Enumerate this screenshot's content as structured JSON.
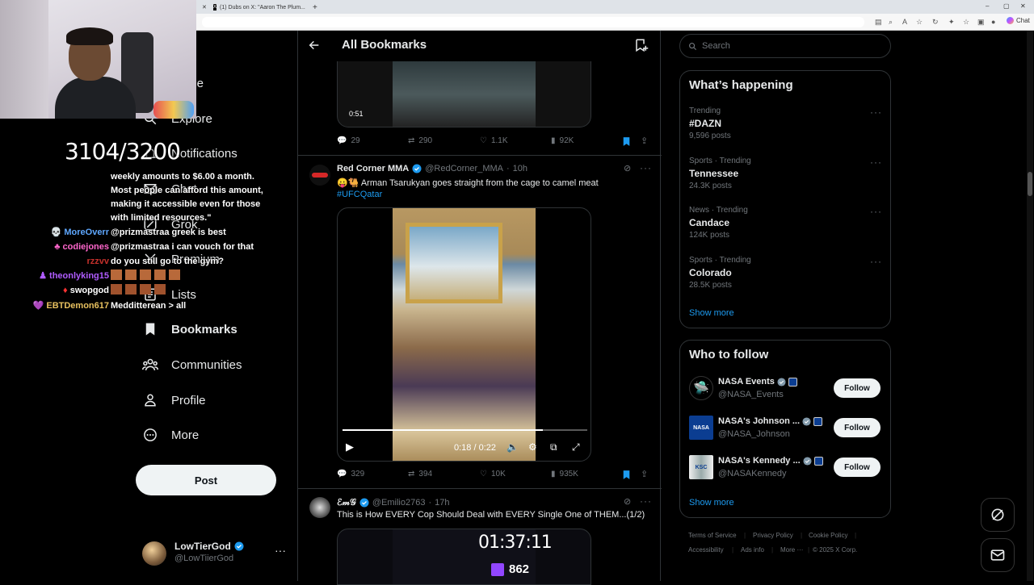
{
  "browser": {
    "tabs": [
      {
        "label": "(1) Dubs on X: \"Aaron The Plum..."
      }
    ],
    "new_tab": "+",
    "window_controls": [
      "–",
      "▢",
      "✕"
    ],
    "chat_label": "Chat"
  },
  "overlay": {
    "counter": "3104/3200",
    "chat": [
      {
        "user": "",
        "text": "weekly amounts to $6.00 a month."
      },
      {
        "user": "",
        "text": "Most people can afford this amount,"
      },
      {
        "user": "",
        "text": "making it accessible even for those"
      },
      {
        "user": "",
        "text": "with limited resources.\""
      },
      {
        "user": "MoreOverr",
        "text": "@prizmastraa greek is best",
        "color": "#5fa8ff"
      },
      {
        "user": "codiejones",
        "text": "@prizmastraa i can vouch for that",
        "color": "#ff66cc"
      },
      {
        "user": "rzzvv",
        "text": "do you still go to the gym?",
        "color": "#c4302b"
      },
      {
        "user": "theonlyking15",
        "text": "",
        "color": "#b05cff"
      },
      {
        "user": "swopgod",
        "text": "",
        "color": "#ffffff"
      },
      {
        "user": "EBTDemon617",
        "text": "Medditterean > all",
        "color": "#e8c15f"
      }
    ]
  },
  "nav": {
    "items": [
      {
        "label": "Home",
        "icon": "home-icon"
      },
      {
        "label": "Explore",
        "icon": "search-icon"
      },
      {
        "label": "Notifications",
        "icon": "bell-icon"
      },
      {
        "label": "Chat",
        "icon": "mail-icon"
      },
      {
        "label": "Grok",
        "icon": "grok-icon"
      },
      {
        "label": "Premium",
        "icon": "x-logo-icon"
      },
      {
        "label": "Lists",
        "icon": "list-icon"
      },
      {
        "label": "Bookmarks",
        "icon": "bookmark-icon"
      },
      {
        "label": "Communities",
        "icon": "communities-icon"
      },
      {
        "label": "Profile",
        "icon": "person-icon"
      },
      {
        "label": "More",
        "icon": "more-circle-icon"
      }
    ],
    "post_button": "Post",
    "account": {
      "name": "LowTierGod",
      "handle": "@LowTiierGod"
    }
  },
  "header": {
    "title": "All Bookmarks"
  },
  "tweets": [
    {
      "video_time": "0:51",
      "stats": {
        "replies": "29",
        "reposts": "290",
        "likes": "1.1K",
        "views": "92K"
      }
    },
    {
      "name": "Red Corner MMA",
      "handle": "@RedCorner_MMA",
      "time": "10h",
      "text": "😛🐫 Arman Tsarukyan goes straight from the cage to camel meat",
      "hashtag": "#UFCQatar",
      "video_time": "0:18 / 0:22",
      "progress": 0.82,
      "stats": {
        "replies": "329",
        "reposts": "394",
        "likes": "10K",
        "views": "935K"
      }
    },
    {
      "name": "ℰ𝓂𝒢",
      "handle": "@Emilio2763",
      "time": "17h",
      "text": "This is How EVERY Cop Should Deal with EVERY Single One of THEM...(1/2)",
      "overlay_time": "01:37:11",
      "overlay_count": "862"
    }
  ],
  "search": {
    "placeholder": "Search"
  },
  "happening": {
    "title": "What’s happening",
    "trends": [
      {
        "meta": "Trending",
        "title": "#DAZN",
        "sub": "9,596 posts"
      },
      {
        "meta": "Sports · Trending",
        "title": "Tennessee",
        "sub": "24.3K posts"
      },
      {
        "meta": "News · Trending",
        "title": "Candace",
        "sub": "124K posts"
      },
      {
        "meta": "Sports · Trending",
        "title": "Colorado",
        "sub": "28.5K posts"
      }
    ],
    "show_more": "Show more"
  },
  "who_to_follow": {
    "title": "Who to follow",
    "accounts": [
      {
        "name": "NASA Events",
        "handle": "@NASA_Events"
      },
      {
        "name": "NASA's Johnson ...",
        "handle": "@NASA_Johnson"
      },
      {
        "name": "NASA's Kennedy ...",
        "handle": "@NASAKennedy"
      }
    ],
    "follow_label": "Follow",
    "show_more": "Show more"
  },
  "footer": {
    "links": [
      "Terms of Service",
      "Privacy Policy",
      "Cookie Policy",
      "Accessibility",
      "Ads info",
      "More ···",
      "© 2025 X Corp."
    ]
  },
  "colors": {
    "accent": "#1d9bf0",
    "background": "#000000",
    "border": "#2f3336",
    "muted": "#71767b"
  }
}
